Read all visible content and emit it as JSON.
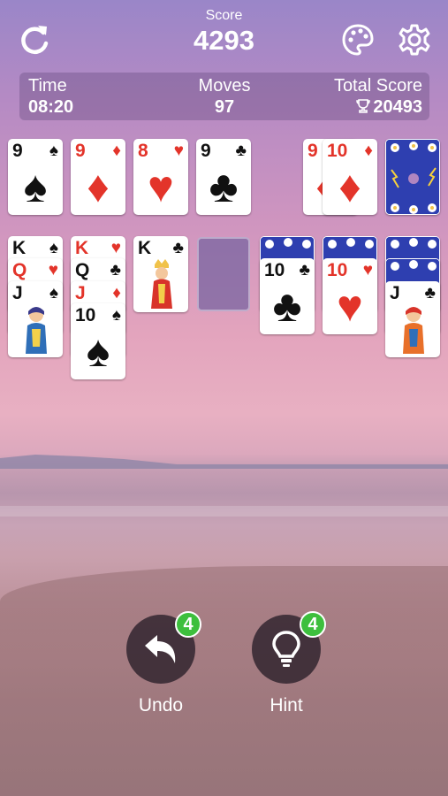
{
  "header": {
    "score_label": "Score",
    "score_value": "4293",
    "icons": {
      "restart": "restart-icon",
      "palette": "palette-icon",
      "settings": "gear-icon"
    }
  },
  "stats": {
    "time_label": "Time",
    "time_value": "08:20",
    "moves_label": "Moves",
    "moves_value": "97",
    "total_label": "Total Score",
    "total_value": "20493"
  },
  "foundations": [
    {
      "rank": "9",
      "suit": "♠",
      "color": "black"
    },
    {
      "rank": "9",
      "suit": "♦",
      "color": "red"
    },
    {
      "rank": "8",
      "suit": "♥",
      "color": "red"
    },
    {
      "rank": "9",
      "suit": "♣",
      "color": "black"
    }
  ],
  "waste": [
    {
      "rank": "9",
      "suit": "♦",
      "color": "red"
    },
    {
      "rank": "10",
      "suit": "♦",
      "color": "red"
    }
  ],
  "tableau": {
    "col1": [
      {
        "rank": "K",
        "suit": "♠",
        "color": "black"
      },
      {
        "rank": "Q",
        "suit": "♥",
        "color": "red"
      },
      {
        "rank": "J",
        "suit": "♠",
        "color": "black"
      }
    ],
    "col2": [
      {
        "rank": "K",
        "suit": "♥",
        "color": "red"
      },
      {
        "rank": "Q",
        "suit": "♣",
        "color": "black"
      },
      {
        "rank": "J",
        "suit": "♦",
        "color": "red"
      },
      {
        "rank": "10",
        "suit": "♠",
        "color": "black"
      }
    ],
    "col3": [
      {
        "rank": "K",
        "suit": "♣",
        "color": "black"
      }
    ],
    "col5": [
      {
        "rank": "10",
        "suit": "♣",
        "color": "black"
      }
    ],
    "col6": [
      {
        "rank": "10",
        "suit": "♥",
        "color": "red"
      }
    ],
    "col7": [
      {
        "rank": "J",
        "suit": "♣",
        "color": "black"
      }
    ]
  },
  "actions": {
    "undo_label": "Undo",
    "undo_count": "4",
    "hint_label": "Hint",
    "hint_count": "4"
  },
  "colors": {
    "red_suit": "#e3342a",
    "badge": "#3dbf3d",
    "card_back": "#2e3fb0"
  }
}
